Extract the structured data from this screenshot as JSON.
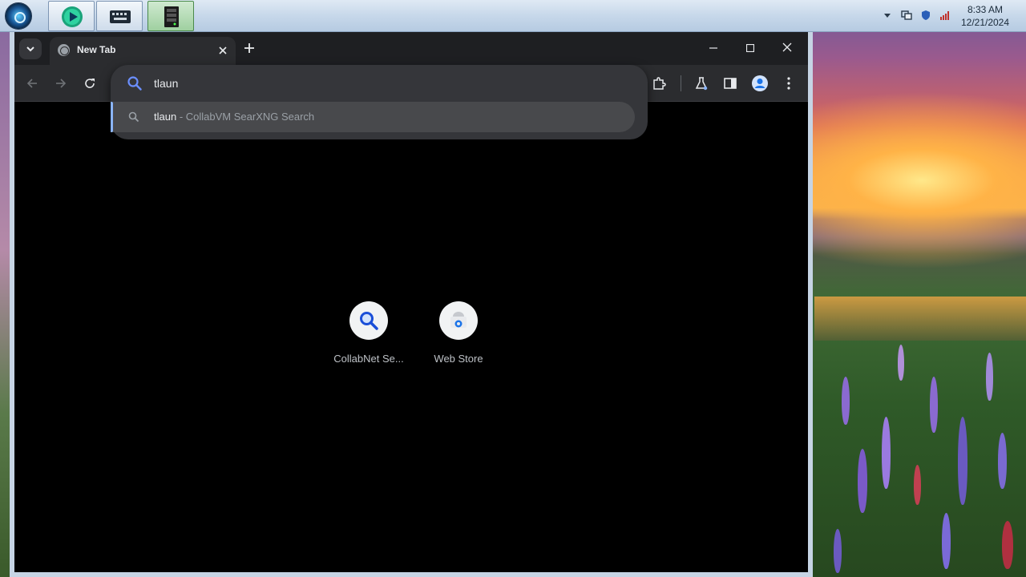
{
  "taskbar": {
    "clock_time": "8:33 AM",
    "clock_date": "12/21/2024",
    "pinned": [
      {
        "icon": "media-player-icon",
        "active": false
      },
      {
        "icon": "keyboard-app-icon",
        "active": false
      },
      {
        "icon": "server-app-icon",
        "active": true
      }
    ],
    "tray_icons": [
      "show-hidden-icons-chevron",
      "network-icon",
      "security-shield-icon",
      "volume-icon"
    ]
  },
  "browser": {
    "tab": {
      "title": "New Tab",
      "favicon": "globe-icon"
    },
    "omnibox": {
      "value": "tlaun",
      "suggestion": {
        "query": "tlaun",
        "separator": " - ",
        "provider": "CollabVM SearXNG Search"
      }
    },
    "shortcuts": [
      {
        "label": "CollabNet Se...",
        "icon": "magnifier-icon"
      },
      {
        "label": "Web Store",
        "icon": "web-store-icon"
      }
    ]
  },
  "colors": {
    "accent": "#8ab4f8",
    "toolbar_bg": "#2b2c2f",
    "tabstrip_bg": "#1e1f22",
    "ntp_bg": "#000000"
  }
}
